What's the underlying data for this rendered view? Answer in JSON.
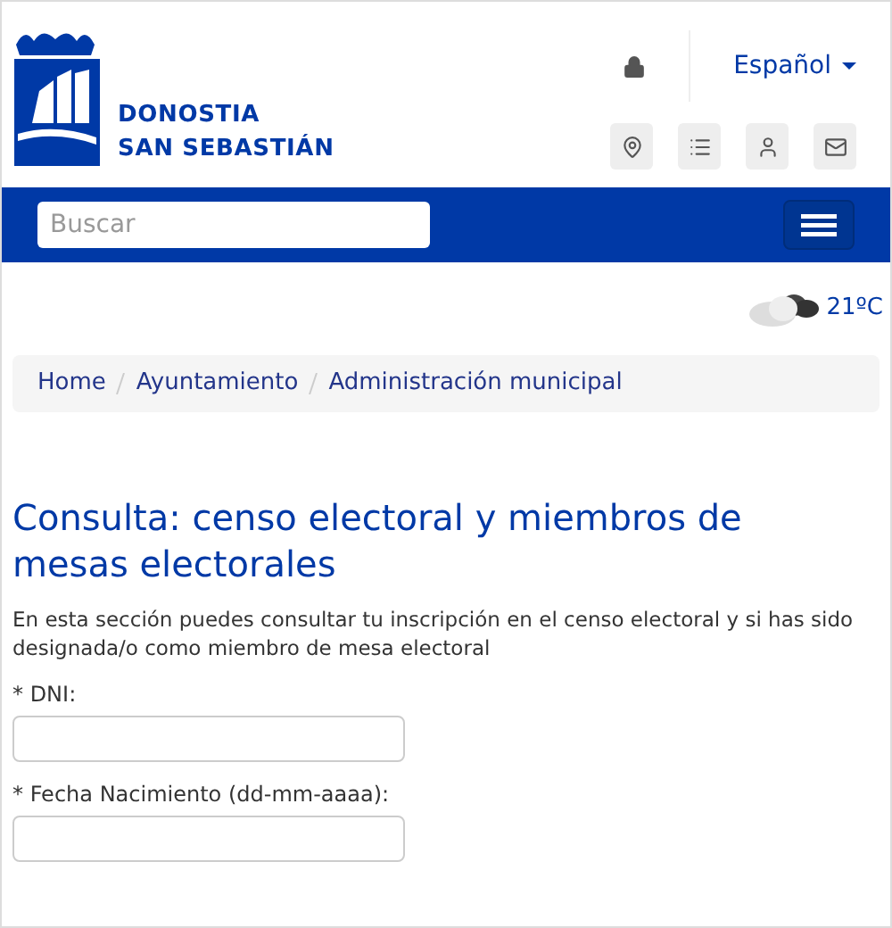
{
  "logo": {
    "lines": [
      "DONOSTIA",
      "SAN SEBASTIÁN"
    ]
  },
  "language": {
    "label": "Español"
  },
  "search": {
    "placeholder": "Buscar"
  },
  "weather": {
    "temperature": "21ºC"
  },
  "breadcrumb": [
    "Home",
    "Ayuntamiento",
    "Administración municipal"
  ],
  "title": "Consulta: censo electoral y miembros de mesas electorales",
  "intro": "En esta sección puedes consultar tu inscripción en el censo electoral y si has sido designada/o como miembro de mesa electoral",
  "fields": [
    {
      "label": "* DNI:"
    },
    {
      "label": "* Fecha Nacimiento (dd-mm-aaaa):"
    }
  ]
}
